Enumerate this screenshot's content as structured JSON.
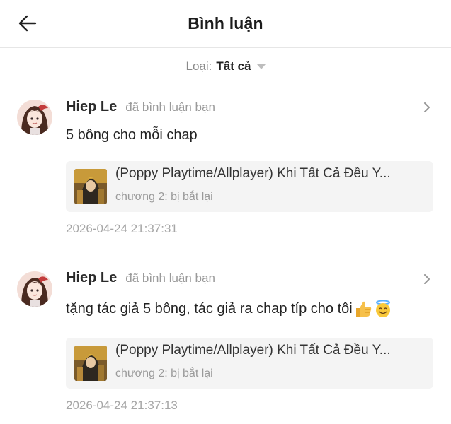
{
  "header": {
    "title": "Bình luận",
    "back_icon": "arrow-left-icon"
  },
  "filter": {
    "label": "Loại:",
    "value": "Tất cả"
  },
  "colors": {
    "text": "#222222",
    "muted": "#9a9a9a",
    "card_bg": "#f4f4f4",
    "divider": "#ececec"
  },
  "comments": [
    {
      "user": "Hiep Le",
      "action": "đã bình luận bạn",
      "text": "5 bông cho mỗi chap",
      "emojis": [],
      "story": {
        "title": "(Poppy Playtime/Allplayer) Khi Tất Cả Đều Y...",
        "chapter": "chương 2: bị bắt lại"
      },
      "time": "2026-04-24 21:37:31"
    },
    {
      "user": "Hiep Le",
      "action": "đã bình luận bạn",
      "text": "tặng tác giả 5 bông, tác giả ra chap típ cho tôi",
      "emojis": [
        "thumbs-up",
        "smiling-face-with-halo"
      ],
      "story": {
        "title": "(Poppy Playtime/Allplayer) Khi Tất Cả Đều Y...",
        "chapter": "chương 2: bị bắt lại"
      },
      "time": "2026-04-24 21:37:13"
    }
  ]
}
